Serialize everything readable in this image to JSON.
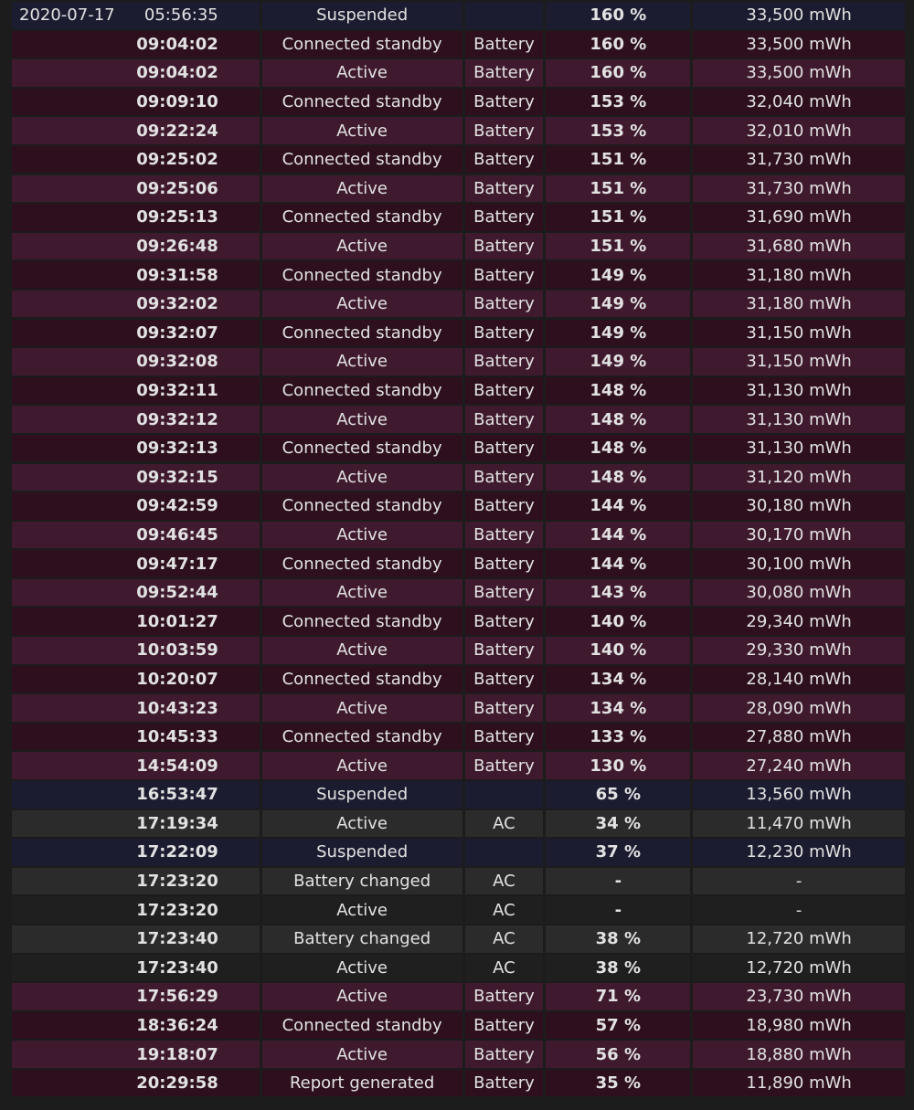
{
  "rows": [
    {
      "date": "2020-07-17",
      "time": "05:56:35",
      "state": "Suspended",
      "source": "",
      "pct": "160 %",
      "cap": "33,500 mWh",
      "kind": "suspended"
    },
    {
      "date": "",
      "time": "09:04:02",
      "state": "Connected standby",
      "source": "Battery",
      "pct": "160 %",
      "cap": "33,500 mWh",
      "kind": "standby"
    },
    {
      "date": "",
      "time": "09:04:02",
      "state": "Active",
      "source": "Battery",
      "pct": "160 %",
      "cap": "33,500 mWh",
      "kind": "active"
    },
    {
      "date": "",
      "time": "09:09:10",
      "state": "Connected standby",
      "source": "Battery",
      "pct": "153 %",
      "cap": "32,040 mWh",
      "kind": "standby"
    },
    {
      "date": "",
      "time": "09:22:24",
      "state": "Active",
      "source": "Battery",
      "pct": "153 %",
      "cap": "32,010 mWh",
      "kind": "active"
    },
    {
      "date": "",
      "time": "09:25:02",
      "state": "Connected standby",
      "source": "Battery",
      "pct": "151 %",
      "cap": "31,730 mWh",
      "kind": "standby"
    },
    {
      "date": "",
      "time": "09:25:06",
      "state": "Active",
      "source": "Battery",
      "pct": "151 %",
      "cap": "31,730 mWh",
      "kind": "active"
    },
    {
      "date": "",
      "time": "09:25:13",
      "state": "Connected standby",
      "source": "Battery",
      "pct": "151 %",
      "cap": "31,690 mWh",
      "kind": "standby"
    },
    {
      "date": "",
      "time": "09:26:48",
      "state": "Active",
      "source": "Battery",
      "pct": "151 %",
      "cap": "31,680 mWh",
      "kind": "active"
    },
    {
      "date": "",
      "time": "09:31:58",
      "state": "Connected standby",
      "source": "Battery",
      "pct": "149 %",
      "cap": "31,180 mWh",
      "kind": "standby"
    },
    {
      "date": "",
      "time": "09:32:02",
      "state": "Active",
      "source": "Battery",
      "pct": "149 %",
      "cap": "31,180 mWh",
      "kind": "active"
    },
    {
      "date": "",
      "time": "09:32:07",
      "state": "Connected standby",
      "source": "Battery",
      "pct": "149 %",
      "cap": "31,150 mWh",
      "kind": "standby"
    },
    {
      "date": "",
      "time": "09:32:08",
      "state": "Active",
      "source": "Battery",
      "pct": "149 %",
      "cap": "31,150 mWh",
      "kind": "active"
    },
    {
      "date": "",
      "time": "09:32:11",
      "state": "Connected standby",
      "source": "Battery",
      "pct": "148 %",
      "cap": "31,130 mWh",
      "kind": "standby"
    },
    {
      "date": "",
      "time": "09:32:12",
      "state": "Active",
      "source": "Battery",
      "pct": "148 %",
      "cap": "31,130 mWh",
      "kind": "active"
    },
    {
      "date": "",
      "time": "09:32:13",
      "state": "Connected standby",
      "source": "Battery",
      "pct": "148 %",
      "cap": "31,130 mWh",
      "kind": "standby"
    },
    {
      "date": "",
      "time": "09:32:15",
      "state": "Active",
      "source": "Battery",
      "pct": "148 %",
      "cap": "31,120 mWh",
      "kind": "active"
    },
    {
      "date": "",
      "time": "09:42:59",
      "state": "Connected standby",
      "source": "Battery",
      "pct": "144 %",
      "cap": "30,180 mWh",
      "kind": "standby"
    },
    {
      "date": "",
      "time": "09:46:45",
      "state": "Active",
      "source": "Battery",
      "pct": "144 %",
      "cap": "30,170 mWh",
      "kind": "active"
    },
    {
      "date": "",
      "time": "09:47:17",
      "state": "Connected standby",
      "source": "Battery",
      "pct": "144 %",
      "cap": "30,100 mWh",
      "kind": "standby"
    },
    {
      "date": "",
      "time": "09:52:44",
      "state": "Active",
      "source": "Battery",
      "pct": "143 %",
      "cap": "30,080 mWh",
      "kind": "active"
    },
    {
      "date": "",
      "time": "10:01:27",
      "state": "Connected standby",
      "source": "Battery",
      "pct": "140 %",
      "cap": "29,340 mWh",
      "kind": "standby"
    },
    {
      "date": "",
      "time": "10:03:59",
      "state": "Active",
      "source": "Battery",
      "pct": "140 %",
      "cap": "29,330 mWh",
      "kind": "active"
    },
    {
      "date": "",
      "time": "10:20:07",
      "state": "Connected standby",
      "source": "Battery",
      "pct": "134 %",
      "cap": "28,140 mWh",
      "kind": "standby"
    },
    {
      "date": "",
      "time": "10:43:23",
      "state": "Active",
      "source": "Battery",
      "pct": "134 %",
      "cap": "28,090 mWh",
      "kind": "active"
    },
    {
      "date": "",
      "time": "10:45:33",
      "state": "Connected standby",
      "source": "Battery",
      "pct": "133 %",
      "cap": "27,880 mWh",
      "kind": "standby"
    },
    {
      "date": "",
      "time": "14:54:09",
      "state": "Active",
      "source": "Battery",
      "pct": "130 %",
      "cap": "27,240 mWh",
      "kind": "active"
    },
    {
      "date": "",
      "time": "16:53:47",
      "state": "Suspended",
      "source": "",
      "pct": "65 %",
      "cap": "13,560 mWh",
      "kind": "suspended"
    },
    {
      "date": "",
      "time": "17:19:34",
      "state": "Active",
      "source": "AC",
      "pct": "34 %",
      "cap": "11,470 mWh",
      "kind": "ac-changed"
    },
    {
      "date": "",
      "time": "17:22:09",
      "state": "Suspended",
      "source": "",
      "pct": "37 %",
      "cap": "12,230 mWh",
      "kind": "suspended"
    },
    {
      "date": "",
      "time": "17:23:20",
      "state": "Battery changed",
      "source": "AC",
      "pct": "-",
      "cap": "-",
      "kind": "ac-changed"
    },
    {
      "date": "",
      "time": "17:23:20",
      "state": "Active",
      "source": "AC",
      "pct": "-",
      "cap": "-",
      "kind": "ac-active"
    },
    {
      "date": "",
      "time": "17:23:40",
      "state": "Battery changed",
      "source": "AC",
      "pct": "38 %",
      "cap": "12,720 mWh",
      "kind": "ac-changed"
    },
    {
      "date": "",
      "time": "17:23:40",
      "state": "Active",
      "source": "AC",
      "pct": "38 %",
      "cap": "12,720 mWh",
      "kind": "ac-active"
    },
    {
      "date": "",
      "time": "17:56:29",
      "state": "Active",
      "source": "Battery",
      "pct": "71 %",
      "cap": "23,730 mWh",
      "kind": "active"
    },
    {
      "date": "",
      "time": "18:36:24",
      "state": "Connected standby",
      "source": "Battery",
      "pct": "57 %",
      "cap": "18,980 mWh",
      "kind": "standby"
    },
    {
      "date": "",
      "time": "19:18:07",
      "state": "Active",
      "source": "Battery",
      "pct": "56 %",
      "cap": "18,880 mWh",
      "kind": "active"
    },
    {
      "date": "",
      "time": "20:29:58",
      "state": "Report generated",
      "source": "Battery",
      "pct": "35 %",
      "cap": "11,890 mWh",
      "kind": "report"
    }
  ],
  "colors": {
    "background": "#1c1c1c",
    "active_battery": "#3f1a2e",
    "standby_battery": "#2d0f1d",
    "suspended": "#1b1c30",
    "ac_active": "#1f1f1f",
    "ac_changed": "#2b2b2b",
    "text": "#e2e2e2"
  }
}
